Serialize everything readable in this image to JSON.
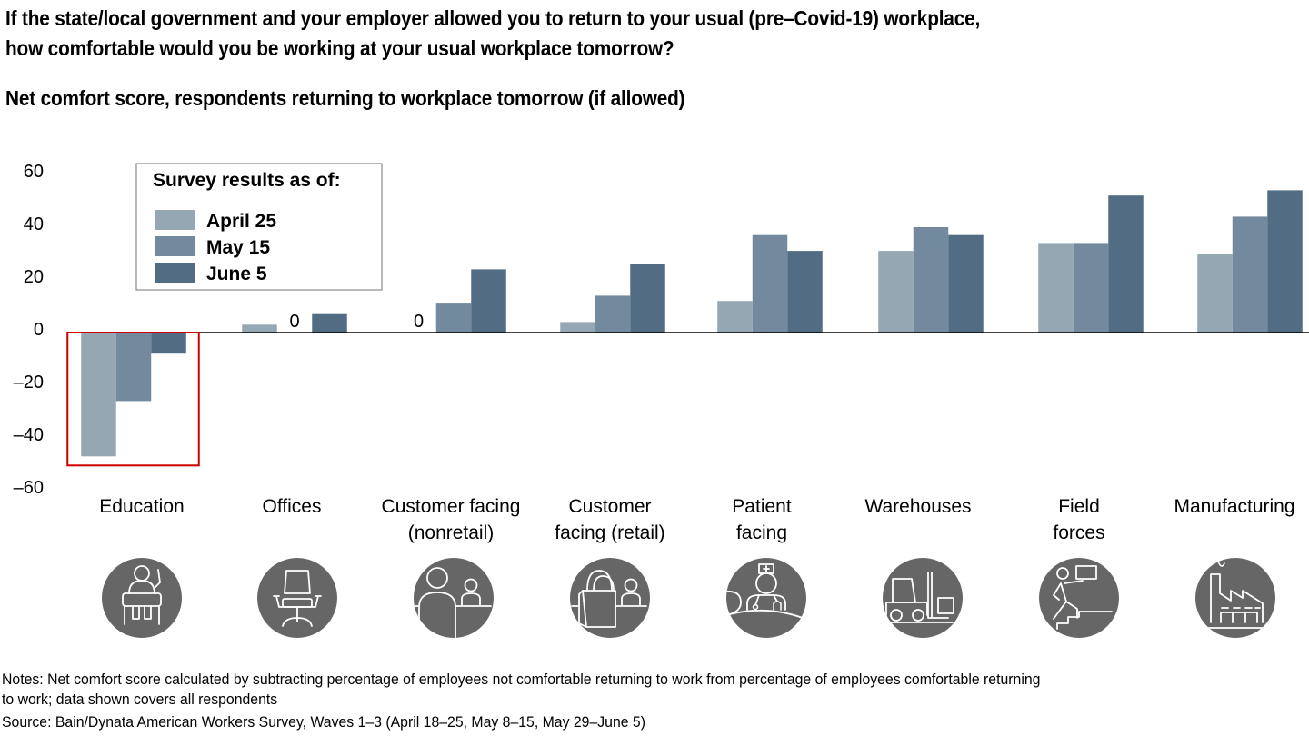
{
  "header": {
    "question_line1": "If the state/local government and your employer allowed you to return to your usual (pre–Covid-19) workplace,",
    "question_line2": "how comfortable would you be working at your usual workplace tomorrow?",
    "subtitle": "Net comfort score, respondents returning to workplace tomorrow (if allowed)"
  },
  "footer": {
    "notes_line1": "Notes: Net comfort score calculated by subtracting percentage of employees not comfortable returning to work from percentage of employees comfortable returning",
    "notes_line2": "to work; data shown covers all respondents",
    "source": "Source: Bain/Dynata American Workers Survey, Waves 1–3 (April 18–25, May 8–15, May 29–June 5)"
  },
  "chart_data": {
    "type": "bar",
    "title": "Net comfort score, respondents returning to workplace tomorrow (if allowed)",
    "xlabel": "",
    "ylabel": "",
    "ylim": [
      -60,
      60
    ],
    "yticks": [
      60,
      40,
      20,
      0,
      -20,
      -40,
      -60
    ],
    "ytick_labels": [
      "60",
      "40",
      "20",
      "0",
      "–20",
      "–40",
      "–60"
    ],
    "grid": false,
    "legend": {
      "title": "Survey results as of:",
      "placement": "top-left"
    },
    "categories": [
      {
        "label_lines": [
          "Education"
        ],
        "icon": "student-desk-icon"
      },
      {
        "label_lines": [
          "Offices"
        ],
        "icon": "office-chair-icon"
      },
      {
        "label_lines": [
          "Customer facing",
          "(nonretail)"
        ],
        "icon": "customer-counter-icon"
      },
      {
        "label_lines": [
          "Customer",
          "facing (retail)"
        ],
        "icon": "shopping-bag-icon"
      },
      {
        "label_lines": [
          "Patient",
          "facing"
        ],
        "icon": "nurse-icon"
      },
      {
        "label_lines": [
          "Warehouses"
        ],
        "icon": "forklift-icon"
      },
      {
        "label_lines": [
          "Field",
          "forces"
        ],
        "icon": "courier-stairs-icon"
      },
      {
        "label_lines": [
          "Manufacturing"
        ],
        "icon": "factory-icon"
      }
    ],
    "series": [
      {
        "name": "April 25",
        "color": "#96a7b4",
        "values": [
          -47,
          3,
          0,
          4,
          12,
          31,
          34,
          30
        ]
      },
      {
        "name": "May 15",
        "color": "#738a9e",
        "values": [
          -26,
          0,
          11,
          14,
          37,
          40,
          34,
          44
        ]
      },
      {
        "name": "June 5",
        "color": "#526c83",
        "values": [
          -8,
          7,
          24,
          26,
          31,
          37,
          52,
          54
        ]
      }
    ],
    "zero_labels": [
      {
        "category_index": 1,
        "series_index": 1,
        "text": "0"
      },
      {
        "category_index": 2,
        "series_index": 0,
        "text": "0"
      }
    ],
    "highlight": {
      "category_index": 0,
      "color": "#cc0000"
    },
    "icon_color": "#666666"
  }
}
